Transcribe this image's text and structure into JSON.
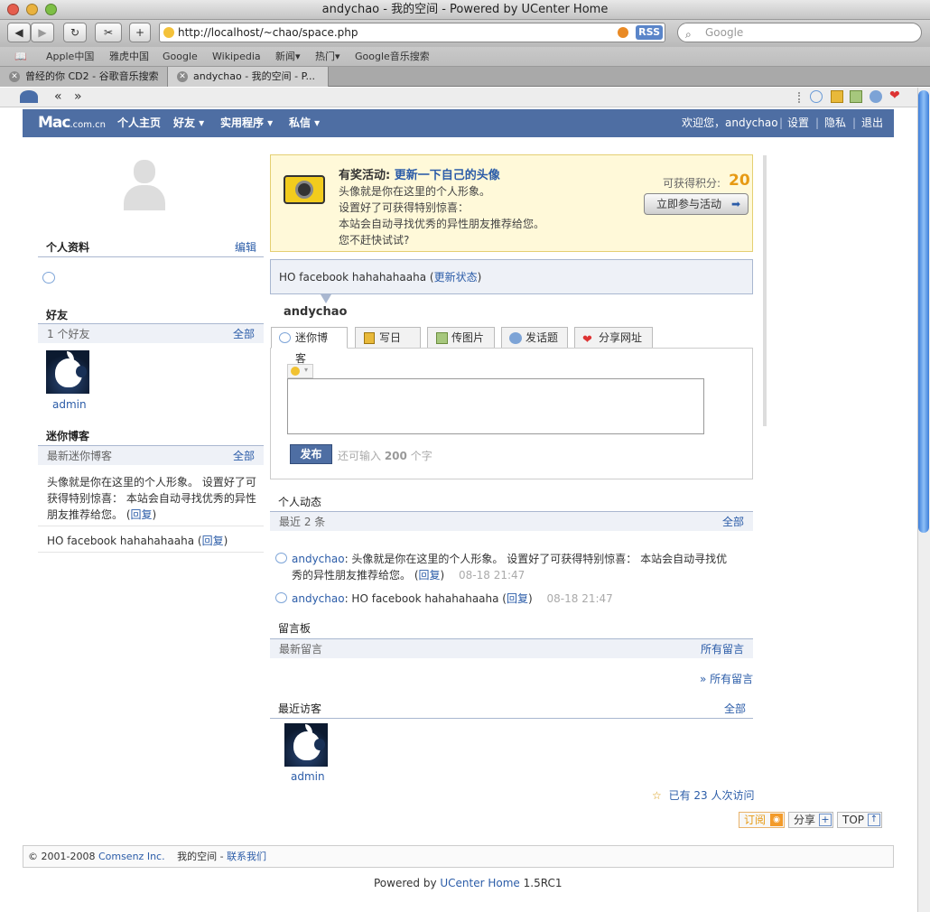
{
  "window": {
    "title": "andychao - 我的空间 - Powered by UCenter Home"
  },
  "toolbar": {
    "url": "http://localhost/~chao/space.php",
    "rss": "RSS",
    "search_placeholder": "Google",
    "add": "+"
  },
  "bookmarks": [
    "Apple中国",
    "雅虎中国",
    "Google",
    "Wikipedia",
    "新闻▾",
    "热门▾",
    "Google音乐搜索"
  ],
  "tabs": [
    {
      "label": "曾经的你 CD2 - 谷歌音乐搜索"
    },
    {
      "label": "andychao - 我的空间 - P..."
    }
  ],
  "extbar": {
    "back": "«",
    "fwd": "»"
  },
  "site": {
    "logo": "Mac",
    "logo_sub": ".com.cn",
    "nav": [
      "个人主页",
      "好友 ▾",
      "实用程序 ▾",
      "私信 ▾"
    ],
    "user_links": {
      "welcome": "欢迎您，andychao",
      "settings": "设置",
      "privacy": "隐私",
      "logout": "退出"
    }
  },
  "left": {
    "profile_head": "个人资料",
    "profile_edit": "编辑",
    "friends_head": "好友",
    "friends_count": "1 个好友",
    "friends_all": "全部",
    "friend_name": "admin",
    "miniblog_head": "迷你博客",
    "miniblog_sub": "最新迷你博客",
    "miniblog_all": "全部",
    "post1": "头像就是你在这里的个人形象。 设置好了可获得特别惊喜： 本站会自动寻找优秀的异性朋友推荐给您。 (",
    "post1_reply": "回复",
    "post1_close": ")",
    "post2": "HO facebook hahahahaaha (",
    "post2_reply": "回复",
    "post2_close": ")"
  },
  "promo": {
    "title_prefix": "有奖活动: ",
    "title_link": "更新一下自己的头像",
    "lines": [
      "头像就是你在这里的个人形象。",
      "设置好了可获得特别惊喜：",
      "本站会自动寻找优秀的异性朋友推荐给您。",
      "您不赶快试试?"
    ],
    "points_label": "可获得积分:",
    "points_value": "20",
    "join_button": "立即参与活动"
  },
  "status": {
    "text": "HO facebook hahahahaaha (",
    "update_link": "更新状态",
    "close": ")"
  },
  "username": "andychao",
  "tabs_main": [
    "迷你博客",
    "写日志",
    "传图片",
    "发话题",
    "分享网址"
  ],
  "composer": {
    "submit": "发布",
    "remaining_prefix": "还可输入 ",
    "remaining_count": "200",
    "remaining_suffix": " 个字"
  },
  "feed": {
    "head": "个人动态",
    "sub": "最近 2 条",
    "all": "全部",
    "items": [
      {
        "user": "andychao",
        "text1": ": 头像就是你在这里的个人形象。 设置好了可获得特别惊喜： 本站会自动寻找优",
        "text2": "秀的异性朋友推荐给您。 (",
        "reply": "回复",
        "close": ")",
        "time": "08-18 21:47"
      },
      {
        "user": "andychao",
        "text1": ": HO facebook hahahahaaha (",
        "reply": "回复",
        "close": ")",
        "time": "08-18 21:47"
      }
    ]
  },
  "guestbook": {
    "head": "留言板",
    "sub": "最新留言",
    "all": "所有留言",
    "more": "» 所有留言"
  },
  "visitors": {
    "head": "最近访客",
    "all": "全部",
    "name": "admin",
    "count_prefix": "已有 ",
    "count": "23",
    "count_suffix": " 人次访问"
  },
  "footer_buttons": {
    "subscribe": "订阅",
    "share": "分享",
    "top": "TOP"
  },
  "footer": {
    "copyright": "© 2001-2008 ",
    "company": "Comsenz Inc.",
    "space": "我的空间 - ",
    "contact": "联系我们"
  },
  "powered": {
    "prefix": "Powered by ",
    "link": "UCenter Home",
    "version": " 1.5RC1"
  },
  "colors": {
    "header_blue": "#4e6ea3",
    "link": "#2b5ca8",
    "promo_bg": "#fff9d9",
    "points": "#e79a14"
  }
}
